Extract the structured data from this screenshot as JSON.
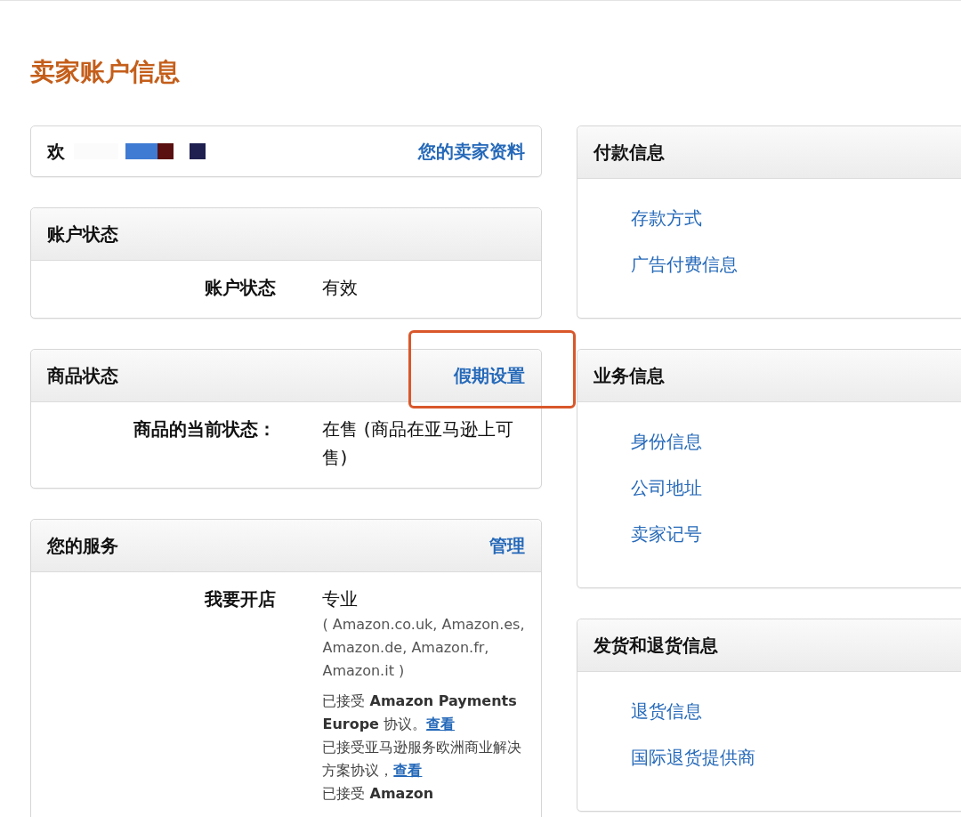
{
  "page_title": "卖家账户信息",
  "welcome": {
    "text": "欢",
    "link": "您的卖家资料"
  },
  "left_cards": [
    {
      "title": "账户状态",
      "rows": [
        {
          "label": "账户状态",
          "value": "有效"
        }
      ]
    },
    {
      "title": "商品状态",
      "action": "假期设置",
      "highlighted": true,
      "rows": [
        {
          "label": "商品的当前状态：",
          "value": "在售 (商品在亚马逊上可售)"
        }
      ]
    },
    {
      "title": "您的服务",
      "action": "管理",
      "rows": [
        {
          "label": "我要开店",
          "value": "专业",
          "note": "( Amazon.co.uk, Amazon.es, Amazon.de, Amazon.fr, Amazon.it )",
          "agreements": [
            {
              "text": "已接受 **Amazon Payments Europe** 协议。",
              "link": "查看"
            },
            {
              "text": "已接受亚马逊服务欧洲商业解决方案协议，",
              "link": "查看"
            },
            {
              "text": "已接受 **Amazon**"
            }
          ]
        }
      ]
    }
  ],
  "right_cards": [
    {
      "title": "付款信息",
      "links": [
        "存款方式",
        "广告付费信息"
      ]
    },
    {
      "title": "业务信息",
      "links": [
        "身份信息",
        "公司地址",
        "卖家记号"
      ]
    },
    {
      "title": "发货和退货信息",
      "links": [
        "退货信息",
        "国际退货提供商"
      ]
    }
  ]
}
